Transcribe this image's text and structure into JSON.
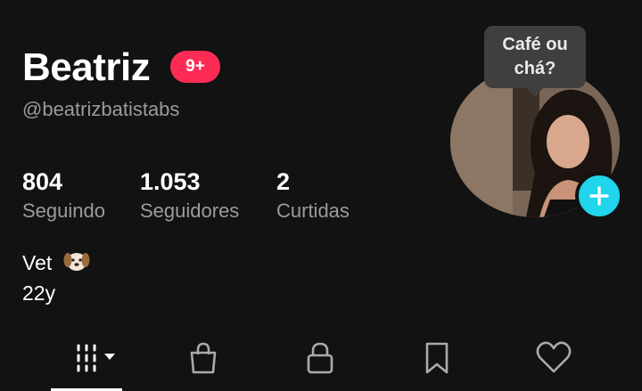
{
  "profile": {
    "name": "Beatriz",
    "notification_badge": "9+",
    "handle": "@beatrizbatistabs",
    "bio_line1": "Vet",
    "bio_line2": "22y"
  },
  "stats": [
    {
      "value": "804",
      "label": "Seguindo"
    },
    {
      "value": "1.053",
      "label": "Seguidores"
    },
    {
      "value": "2",
      "label": "Curtidas"
    }
  ],
  "avatar": {
    "note_bubble": "Café ou chá?"
  },
  "tabs": [
    {
      "icon": "grid-icon"
    },
    {
      "icon": "shopping-bag-icon"
    },
    {
      "icon": "lock-icon"
    },
    {
      "icon": "bookmark-icon"
    },
    {
      "icon": "heart-icon"
    }
  ],
  "colors": {
    "background": "#121212",
    "badge": "#fe2c55",
    "add_button": "#20d5ec",
    "secondary_text": "#9b9b9b"
  }
}
